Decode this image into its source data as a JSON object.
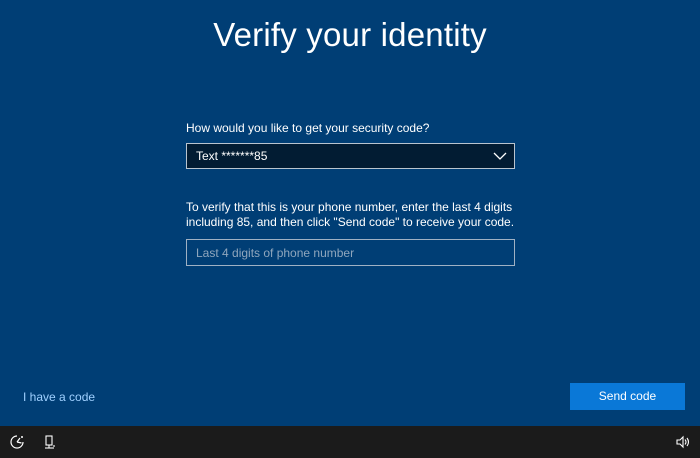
{
  "header": {
    "title": "Verify your identity"
  },
  "form": {
    "method_prompt": "How would you like to get your security code?",
    "method_selected": "Text *******85",
    "instructions": "To verify that this is your phone number, enter the last 4 digits including 85, and then click \"Send code\" to receive your code.",
    "phone_placeholder": "Last 4 digits of phone number",
    "phone_value": ""
  },
  "footer": {
    "have_code_link": "I have a code",
    "send_button": "Send code"
  },
  "taskbar": {
    "icons": [
      "ease-of-access-icon",
      "network-icon",
      "volume-icon"
    ]
  },
  "colors": {
    "background": "#003e75",
    "field_dark": "#021c33",
    "accent": "#0a78d7",
    "link": "#9fd0ff",
    "taskbar": "#1b1b1b"
  }
}
